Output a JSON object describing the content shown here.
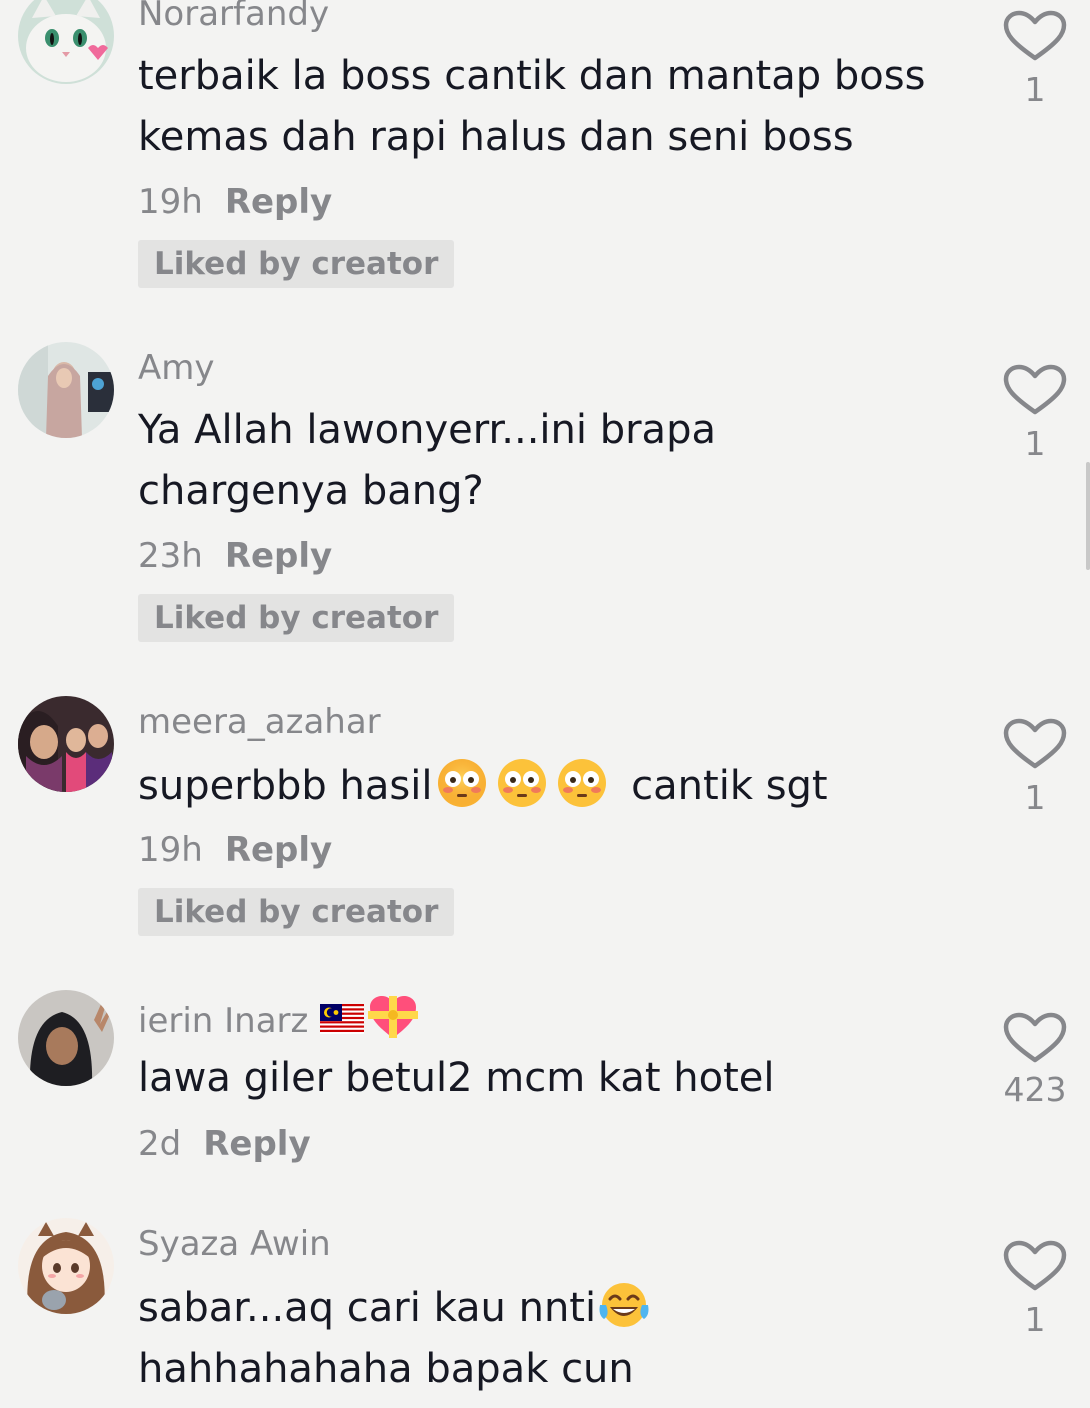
{
  "comments": [
    {
      "username": "Norarfandy",
      "text": "terbaik la boss cantik dan mantap boss kemas dah rapi halus dan seni boss",
      "time": "19h",
      "reply": "Reply",
      "liked_badge": "Liked by creator",
      "likes": "1",
      "avatar_icon": "cat-avatar-icon"
    },
    {
      "username": "Amy",
      "text": "Ya Allah lawonyerr...ini brapa chargenya bang?",
      "time": "23h",
      "reply": "Reply",
      "liked_badge": "Liked by creator",
      "likes": "1",
      "avatar_icon": "person-avatar-icon"
    },
    {
      "username": "meera_azahar",
      "text_before": "superbbb hasil",
      "text_after": "cantik sgt",
      "emojis": [
        "flushed-face-icon",
        "flushed-face-icon",
        "flushed-face-icon"
      ],
      "time": "19h",
      "reply": "Reply",
      "liked_badge": "Liked by creator",
      "likes": "1",
      "avatar_icon": "group-avatar-icon"
    },
    {
      "username": "ierin Inarz",
      "username_icons": [
        "malaysia-flag-icon",
        "heart-ribbon-icon"
      ],
      "text": "lawa giler betul2 mcm kat hotel",
      "time": "2d",
      "reply": "Reply",
      "likes": "423",
      "avatar_icon": "hijab-person-avatar-icon"
    },
    {
      "username": "Syaza Awin",
      "text_before": "sabar...aq cari kau nnti",
      "text_after": " hahhahahaha bapak cun",
      "emojis": [
        "tears-of-joy-icon"
      ],
      "likes": "1",
      "avatar_icon": "anime-girl-avatar-icon"
    }
  ],
  "colors": {
    "background": "#f3f3f2",
    "secondary_text": "#86878b",
    "primary_text": "#161823",
    "badge_bg": "#e3e3e2"
  }
}
